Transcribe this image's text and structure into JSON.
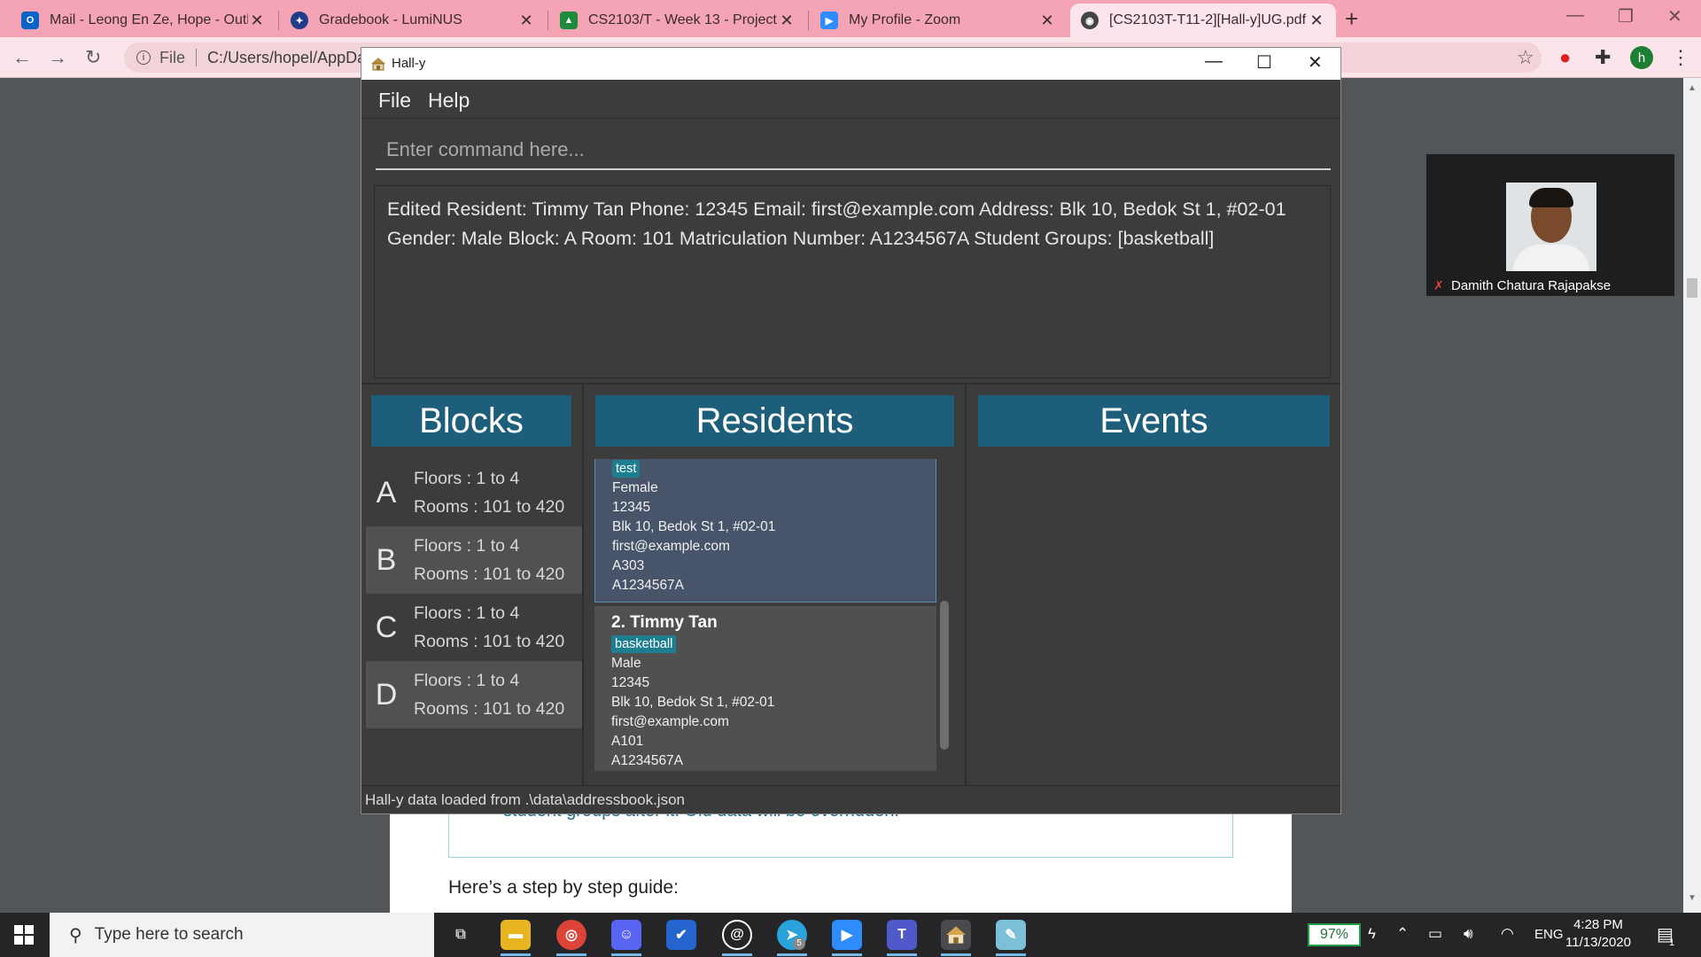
{
  "browser": {
    "tabs": [
      {
        "label": "Mail - Leong En Ze, Hope - Outlo",
        "icon": "outlook-icon",
        "color": "#0a64c7"
      },
      {
        "label": "Gradebook - LumiNUS",
        "icon": "luminus-icon",
        "color": "#1f3c88"
      },
      {
        "label": "CS2103/T - Week 13 - Project",
        "icon": "graduation-cap-icon",
        "color": "#1e8a3c"
      },
      {
        "label": "My Profile - Zoom",
        "icon": "zoom-icon",
        "color": "#2d8cff"
      },
      {
        "label": "[CS2103T-T11-2][Hall-y]UG.pdf",
        "icon": "globe-icon",
        "color": "#444444"
      }
    ],
    "address": {
      "scheme": "File",
      "path": "C:/Users/hopel/AppDat"
    },
    "profile_initial": "h"
  },
  "pdf": {
    "note_text": "student groups after it. Old data will be overridden.",
    "guide_text": "Here’s a step by step guide:"
  },
  "zoom": {
    "participant_name": "Damith Chatura Rajapakse"
  },
  "app": {
    "title": "Hall-y",
    "menu": {
      "file": "File",
      "help": "Help"
    },
    "command_placeholder": "Enter command here...",
    "result_text": "Edited Resident: Timmy Tan Phone: 12345 Email: first@example.com Address: Blk 10, Bedok St 1, #02-01 Gender: Male Block: A Room: 101 Matriculation Number: A1234567A Student Groups: [basketball]",
    "panels": {
      "blocks": "Blocks",
      "residents": "Residents",
      "events": "Events"
    },
    "blocks": [
      {
        "letter": "A",
        "floors": "Floors : 1 to 4",
        "rooms": "Rooms : 101 to 420"
      },
      {
        "letter": "B",
        "floors": "Floors : 1 to 4",
        "rooms": "Rooms : 101 to 420"
      },
      {
        "letter": "C",
        "floors": "Floors : 1 to 4",
        "rooms": "Rooms : 101 to 420"
      },
      {
        "letter": "D",
        "floors": "Floors : 1 to 4",
        "rooms": "Rooms : 101 to 420"
      }
    ],
    "residents": [
      {
        "name": "",
        "tag": "test",
        "gender": "Female",
        "phone": "12345",
        "address": "Blk 10, Bedok St 1, #02-01",
        "email": "first@example.com",
        "room": "A303",
        "matric": "A1234567A"
      },
      {
        "name": "2.  Timmy Tan",
        "tag": "basketball",
        "gender": "Male",
        "phone": "12345",
        "address": "Blk 10, Bedok St 1, #02-01",
        "email": "first@example.com",
        "room": "A101",
        "matric": "A1234567A"
      }
    ],
    "status": "Hall-y data loaded from  .\\data\\addressbook.json"
  },
  "taskbar": {
    "search_placeholder": "Type here to search",
    "battery": "97%",
    "language": "ENG",
    "time": "4:28 PM",
    "date": "11/13/2020",
    "notification_count": "1",
    "telegram_badge": "5"
  },
  "colors": {
    "tab_strip": "#f4a4b4",
    "panel_header": "#1d5f7a",
    "tag": "#1d7e8f",
    "app_bg": "#3c3c3c"
  }
}
